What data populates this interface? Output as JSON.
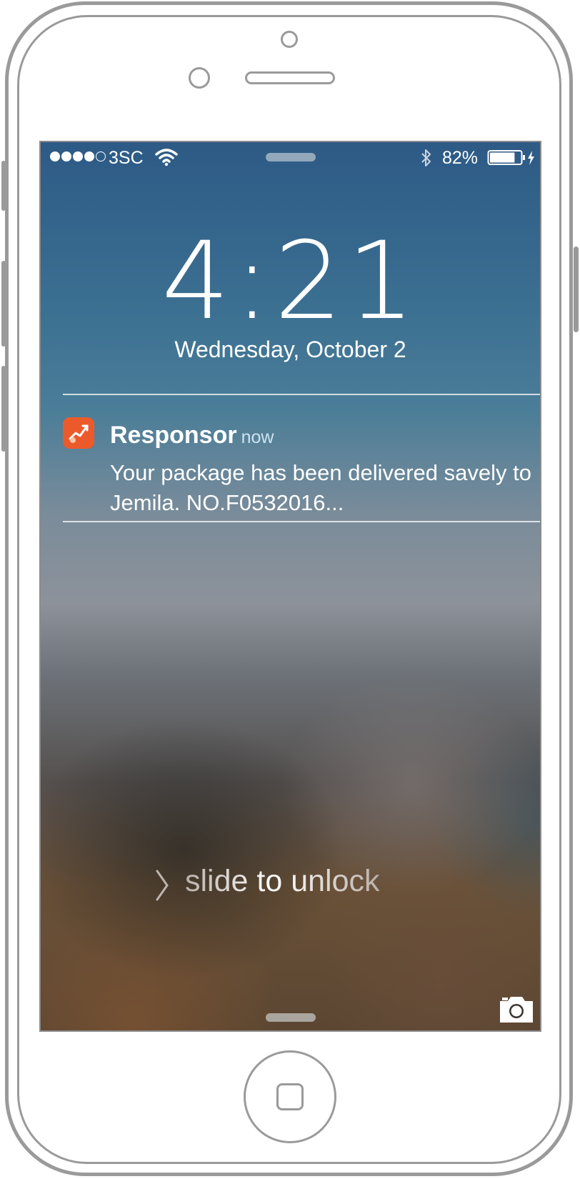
{
  "status_bar": {
    "carrier": "3SC",
    "signal_bars_filled": 4,
    "signal_bars_total": 5,
    "battery_percent_text": "82%",
    "battery_level": 0.82
  },
  "lock_screen": {
    "time": "4:21",
    "date": "Wednesday, October 2",
    "slide_prefix": "slide ",
    "slide_middle": "to",
    "slide_suffix": " unlock"
  },
  "notification": {
    "app_name": "Responsor",
    "time_ago": "now",
    "body": "Your package has been delivered savely to Jemila. NO.F0532016...",
    "icon_color": "#ec5a2b"
  },
  "icons": [
    "wifi-icon",
    "bluetooth-icon",
    "battery-icon",
    "charging-bolt-icon",
    "chevron-right-icon",
    "camera-icon",
    "app-icon"
  ]
}
